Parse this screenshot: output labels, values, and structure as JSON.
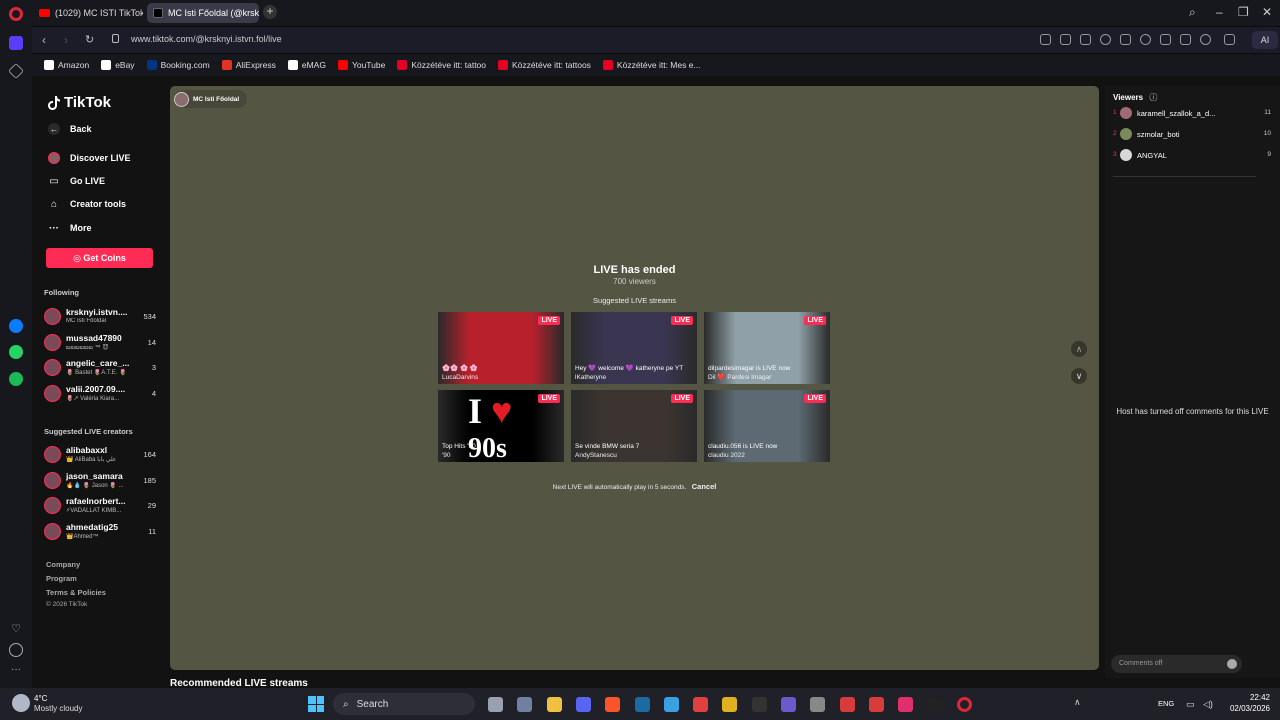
{
  "browser": {
    "tabs": [
      {
        "label": "(1029) MC ISTI TikTok MI..."
      },
      {
        "label": "MC Isti Főoldal (@krsknyi..."
      }
    ],
    "url": "www.tiktok.com/@krsknyi.istvn.fol/live",
    "ai_label": "AI",
    "bookmarks": [
      {
        "label": "Amazon",
        "color": "#ffffff"
      },
      {
        "label": "eBay",
        "color": "#ffffff"
      },
      {
        "label": "Booking.com",
        "color": "#003580"
      },
      {
        "label": "AliExpress",
        "color": "#e43225"
      },
      {
        "label": "eMAG",
        "color": "#ffffff"
      },
      {
        "label": "YouTube",
        "color": "#ff0000"
      },
      {
        "label": "Közzétéve itt: tattoo",
        "color": "#e60023"
      },
      {
        "label": "Közzétéve itt: tattoos",
        "color": "#e60023"
      },
      {
        "label": "Közzétéve itt: Mes e...",
        "color": "#e60023"
      }
    ]
  },
  "tiktok": {
    "logo": "TikTok",
    "nav": {
      "back": "Back",
      "discover": "Discover LIVE",
      "go_live": "Go LIVE",
      "creator_tools": "Creator tools",
      "more": "More",
      "get_coins": "Get Coins"
    },
    "following_title": "Following",
    "following": [
      {
        "name": "krsknyi.istvn....",
        "sub": "MC Isti Főoldal",
        "count": "534"
      },
      {
        "name": "mussad47890",
        "sub": "బబబబబబ ™ 😈",
        "count": "14"
      },
      {
        "name": "angelic_care_...",
        "sub": "🌷 Bastet 🌷A.T.E. 🌷",
        "count": "3"
      },
      {
        "name": "valii.2007.09....",
        "sub": "🌷↗ Valéria Kiara...",
        "count": "4"
      }
    ],
    "suggested_title": "Suggested LIVE creators",
    "suggested": [
      {
        "name": "alibabaxxl",
        "sub": "👑 AliBaba علي بابا",
        "count": "164"
      },
      {
        "name": "jason_samara",
        "sub": "🔥💧 🌷 Jason 🌷 ...",
        "count": "185"
      },
      {
        "name": "rafaelnorbert...",
        "sub": "⚡VADÁLLAT KIMB...",
        "count": "29"
      },
      {
        "name": "ahmedatig25",
        "sub": "👑Ahmed™",
        "count": "11"
      }
    ],
    "footer": {
      "company": "Company",
      "program": "Program",
      "terms": "Terms & Policies",
      "copyright": "© 2026 TikTok"
    },
    "player": {
      "host_name": "MC Isti Főoldal",
      "ended_title": "LIVE has ended",
      "viewers": "700 viewers",
      "suggested_title": "Suggested LIVE streams",
      "live_tag": "LIVE",
      "next_text": "Next LIVE will automatically play in 5 seconds.",
      "cancel": "Cancel",
      "streams": [
        {
          "title": "🌸🌸 🌸 🌸",
          "user": "LucaDarvins",
          "bg": "#b8212c"
        },
        {
          "title": "Hey 💜 welcome 💜 katheryne pe YT",
          "user": "lKatheryne",
          "bg": "#3a3550"
        },
        {
          "title": "dilpardesimagar is LIVE now",
          "user": "Dil ❤️ Pardesi Imagar",
          "bg": "#8fa0a8"
        },
        {
          "title": "Top Hits '90",
          "user": "'90",
          "bg": "#000000"
        },
        {
          "title": "Se vinde BMW seria 7",
          "user": "AndyStanescu",
          "bg": "#3b3430"
        },
        {
          "title": "claudiu.056 is LIVE now",
          "user": "claudiu 2022",
          "bg": "#5d6a74"
        }
      ]
    },
    "recommended_title": "Recommended LIVE streams",
    "viewers_panel": {
      "title": "Viewers",
      "list": [
        {
          "rank": "1",
          "name": "karamell_szallok_a_d...",
          "count": "11"
        },
        {
          "rank": "2",
          "name": "szmolar_boti",
          "count": "10"
        },
        {
          "rank": "3",
          "name": "ANGYAL",
          "count": "9"
        }
      ],
      "comments_off_msg": "Host has turned off comments for this LIVE",
      "comments_placeholder": "Comments off"
    }
  },
  "taskbar": {
    "weather_temp": "4°C",
    "weather_text": "Mostly cloudy",
    "search": "Search",
    "lang": "ENG",
    "time": "22:42",
    "date": "02/03/2026"
  }
}
